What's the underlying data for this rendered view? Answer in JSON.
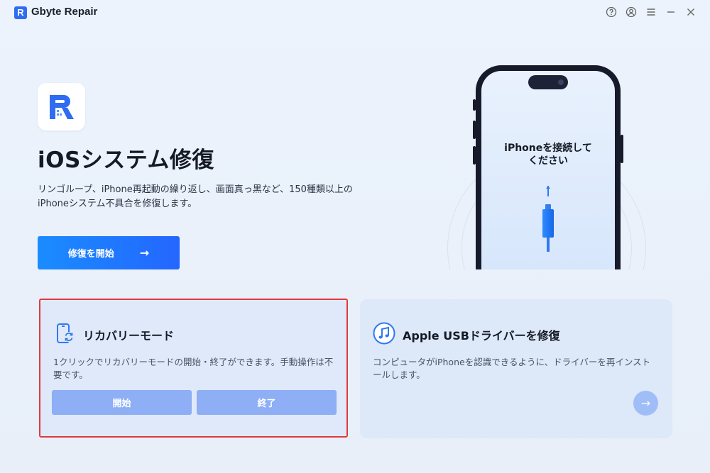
{
  "app": {
    "logo_letter": "R",
    "title": "Gbyte Repair",
    "window_icons": [
      "help-icon",
      "account-icon",
      "menu-icon",
      "minimize-icon",
      "close-icon"
    ]
  },
  "hero": {
    "title": "iOSシステム修復",
    "description": "リンゴループ、iPhone再起動の繰り返し、画面真っ黒など、150種類以上のiPhoneシステム不具合を修復します。",
    "start_button": "修復を開始",
    "start_arrow": "→"
  },
  "phone": {
    "text_line1": "iPhoneを接続して",
    "text_line2": "ください"
  },
  "recovery_card": {
    "title": "リカバリーモード",
    "description": "1クリックでリカバリーモードの開始・終了ができます。手動操作は不要です。",
    "enter_button": "開始",
    "exit_button": "終了"
  },
  "usb_card": {
    "title": "Apple USBドライバーを修復",
    "description": "コンピュータがiPhoneを認識できるように、ドライバーを再インストールします。",
    "go_arrow": "→"
  },
  "colors": {
    "accent": "#2466ff",
    "highlight_border": "#e0393e",
    "card_button": "#8eaef5"
  }
}
